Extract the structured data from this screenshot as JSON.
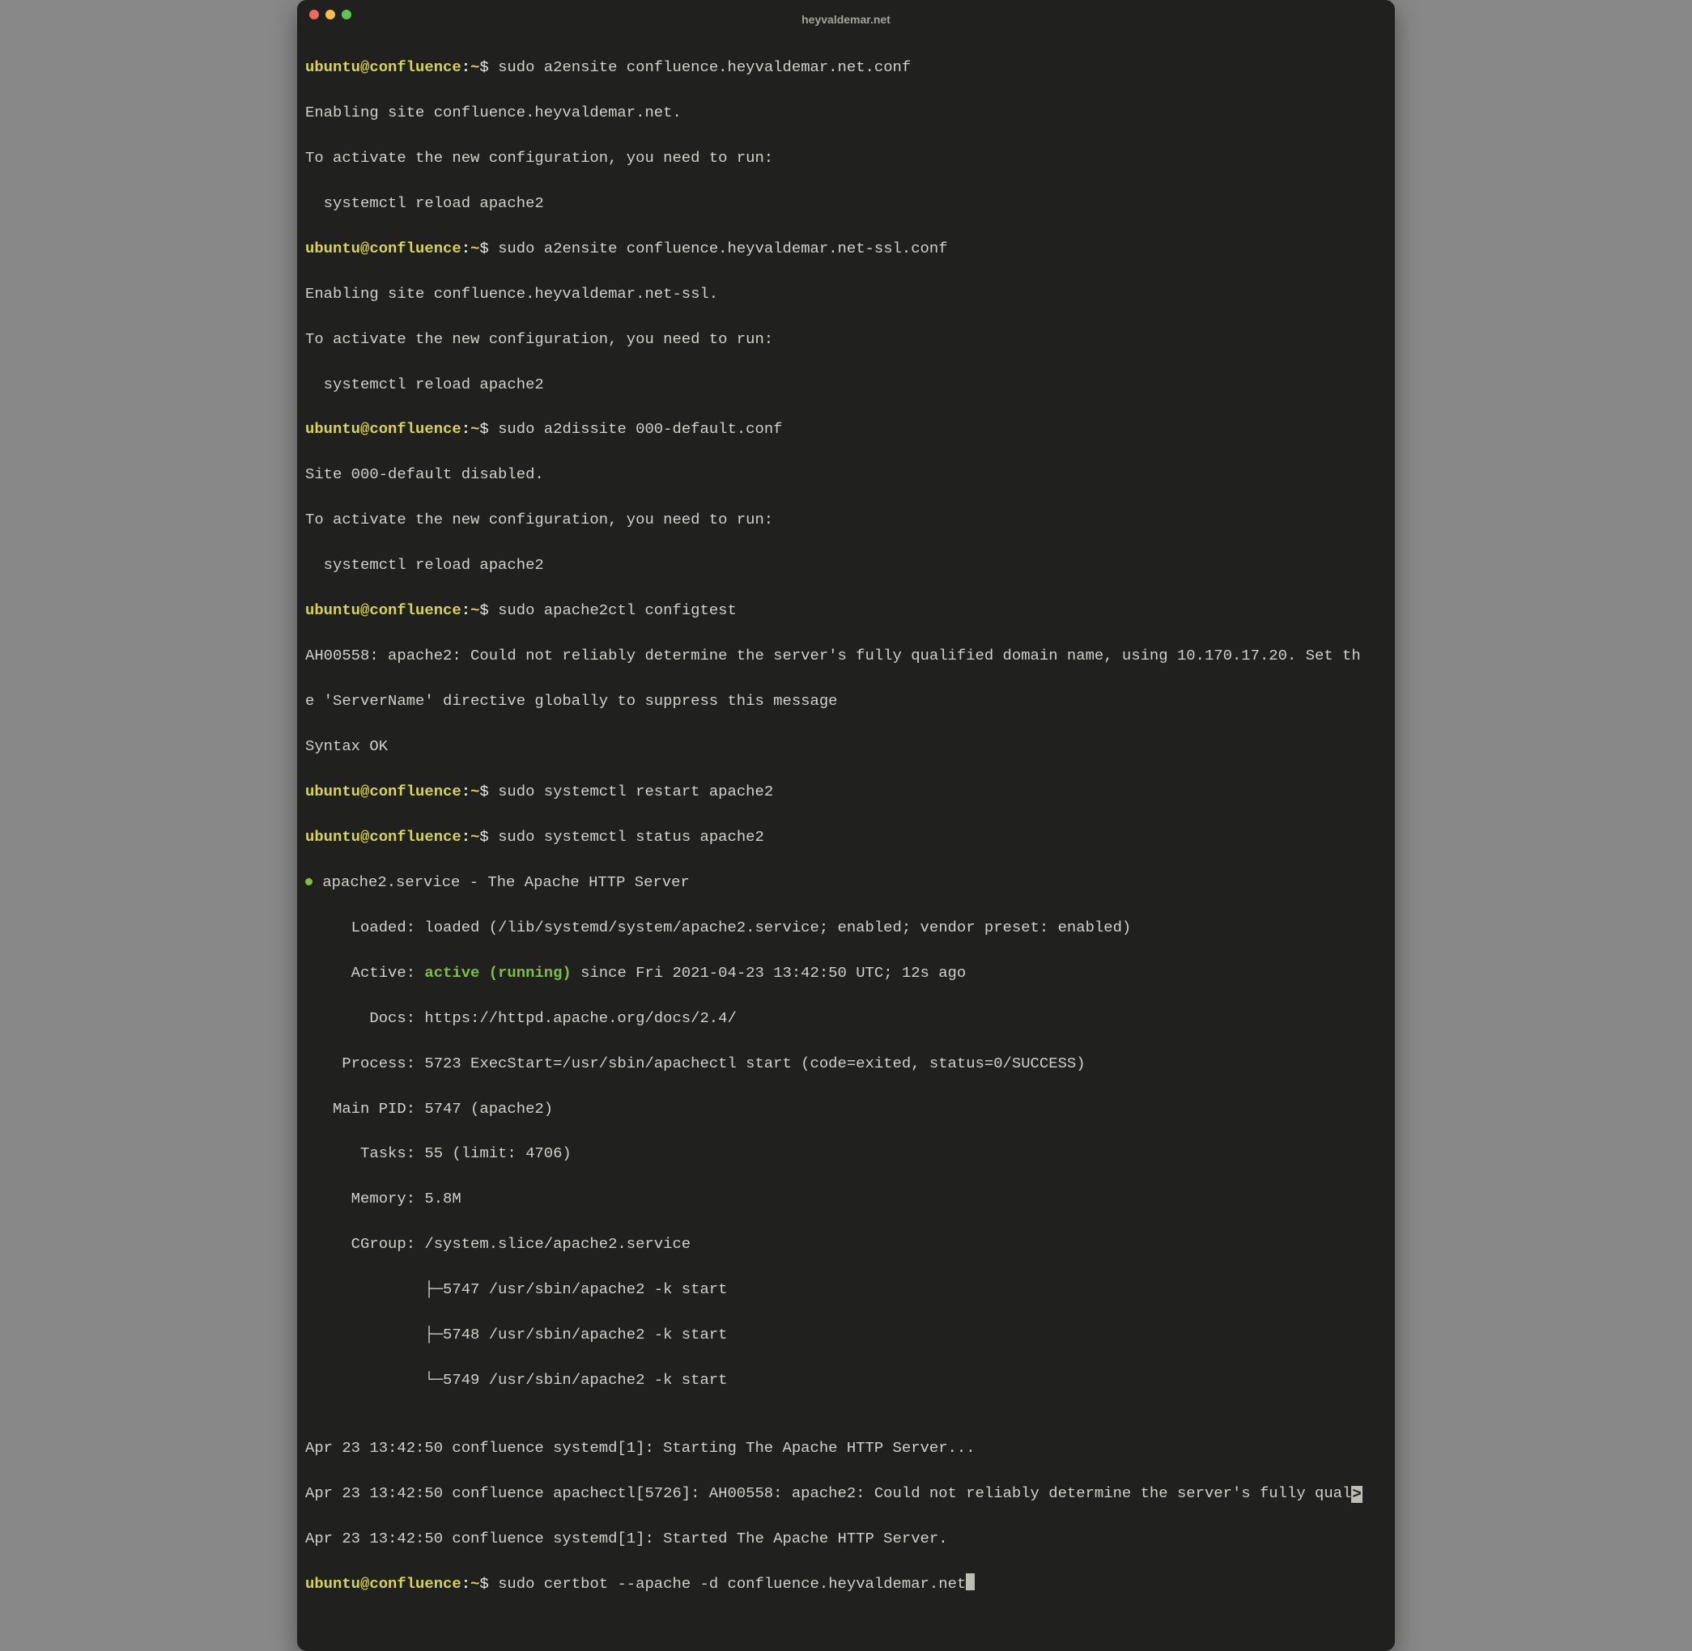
{
  "window": {
    "title": "heyvaldemar.net",
    "traffic": {
      "red": "close",
      "yellow": "minimize",
      "green": "zoom"
    }
  },
  "prompt": {
    "user": "ubuntu@confluence",
    "sep": ":",
    "path": "~",
    "dollar": "$"
  },
  "cmds": [
    "sudo a2ensite confluence.heyvaldemar.net.conf",
    "sudo a2ensite confluence.heyvaldemar.net-ssl.conf",
    "sudo a2dissite 000-default.conf",
    "sudo apache2ctl configtest",
    "sudo systemctl restart apache2",
    "sudo systemctl status apache2",
    "sudo certbot --apache -d confluence.heyvaldemar.net"
  ],
  "out": {
    "en1a": "Enabling site confluence.heyvaldemar.net.",
    "en1b": "To activate the new configuration, you need to run:",
    "en1c": "  systemctl reload apache2",
    "en2a": "Enabling site confluence.heyvaldemar.net-ssl.",
    "en2b": "To activate the new configuration, you need to run:",
    "en2c": "  systemctl reload apache2",
    "dis1": "Site 000-default disabled.",
    "dis2": "To activate the new configuration, you need to run:",
    "dis3": "  systemctl reload apache2",
    "ct1": "AH00558: apache2: Could not reliably determine the server's fully qualified domain name, using 10.170.17.20. Set th",
    "ct2": "e 'ServerName' directive globally to suppress this message",
    "ct3": "Syntax OK",
    "svc_title": " apache2.service - The Apache HTTP Server",
    "svc_loaded": "     Loaded: loaded (/lib/systemd/system/apache2.service; enabled; vendor preset: enabled)",
    "svc_active_label": "     Active: ",
    "svc_active_value": "active (running)",
    "svc_active_tail": " since Fri 2021-04-23 13:42:50 UTC; 12s ago",
    "svc_docs": "       Docs: https://httpd.apache.org/docs/2.4/",
    "svc_process": "    Process: 5723 ExecStart=/usr/sbin/apachectl start (code=exited, status=0/SUCCESS)",
    "svc_mainpid": "   Main PID: 5747 (apache2)",
    "svc_tasks": "      Tasks: 55 (limit: 4706)",
    "svc_memory": "     Memory: 5.8M",
    "svc_cgroup": "     CGroup: /system.slice/apache2.service",
    "svc_cg1": "             ├─5747 /usr/sbin/apache2 -k start",
    "svc_cg2": "             ├─5748 /usr/sbin/apache2 -k start",
    "svc_cg3": "             └─5749 /usr/sbin/apache2 -k start",
    "svc_blank": "",
    "log1": "Apr 23 13:42:50 confluence systemd[1]: Starting The Apache HTTP Server...",
    "log2a": "Apr 23 13:42:50 confluence apachectl[5726]: AH00558: apache2: Could not reliably determine the server's fully qual",
    "log2b": ">",
    "log3": "Apr 23 13:42:50 confluence systemd[1]: Started The Apache HTTP Server."
  }
}
